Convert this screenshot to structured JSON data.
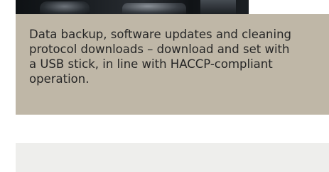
{
  "caption": {
    "text": "Data backup, software updates and cleaning\nprotocol downloads – download and set with\na USB stick, in line with HACCP-compliant\noperation."
  }
}
